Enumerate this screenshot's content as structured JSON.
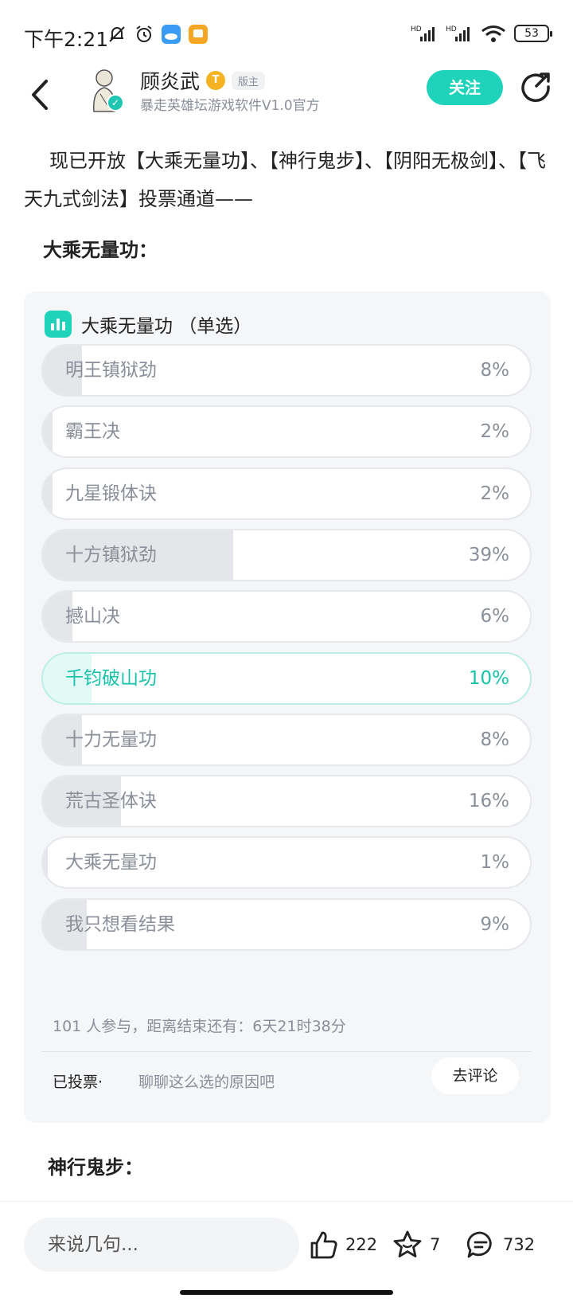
{
  "status_bar": {
    "time": "下午2:21",
    "network_1": "HD",
    "network_2": "HD",
    "battery": "53"
  },
  "header": {
    "author_name": "顾炎武",
    "level_badge": "T",
    "role_tag": "版主",
    "author_subtitle": "暴走英雄坛游戏软件V1.0官方",
    "follow_label": "关注"
  },
  "post": {
    "intro": "现已开放【大乘无量功】、【神行鬼步】、【阴阳无极剑】、【飞天九式剑法】投票通道——",
    "section1": "大乘无量功：",
    "section2": "神行鬼步："
  },
  "poll": {
    "title": "大乘无量功 （单选）",
    "options": [
      {
        "label": "明王镇狱劲",
        "pct": "8%",
        "value": 8,
        "selected": false
      },
      {
        "label": "霸王决",
        "pct": "2%",
        "value": 2,
        "selected": false
      },
      {
        "label": "九星锻体诀",
        "pct": "2%",
        "value": 2,
        "selected": false
      },
      {
        "label": "十方镇狱劲",
        "pct": "39%",
        "value": 39,
        "selected": false
      },
      {
        "label": "撼山决",
        "pct": "6%",
        "value": 6,
        "selected": false
      },
      {
        "label": "千钧破山功",
        "pct": "10%",
        "value": 10,
        "selected": true
      },
      {
        "label": "十力无量功",
        "pct": "8%",
        "value": 8,
        "selected": false
      },
      {
        "label": "荒古圣体诀",
        "pct": "16%",
        "value": 16,
        "selected": false
      },
      {
        "label": "大乘无量功",
        "pct": "1%",
        "value": 1,
        "selected": false
      },
      {
        "label": "我只想看结果",
        "pct": "9%",
        "value": 9,
        "selected": false
      }
    ],
    "meta": "101 人参与，距离结束还有：6天21时38分",
    "voted": "已投票·",
    "voted_hint": "聊聊这么选的原因吧",
    "comment_button": "去评论"
  },
  "bottom_bar": {
    "input_placeholder": "来说几句...",
    "likes": "222",
    "favorites": "7",
    "comments": "732"
  },
  "colors": {
    "accent": "#1fd3bb",
    "selected_text": "#17c2aa",
    "badge_gold": "#f5b323"
  }
}
